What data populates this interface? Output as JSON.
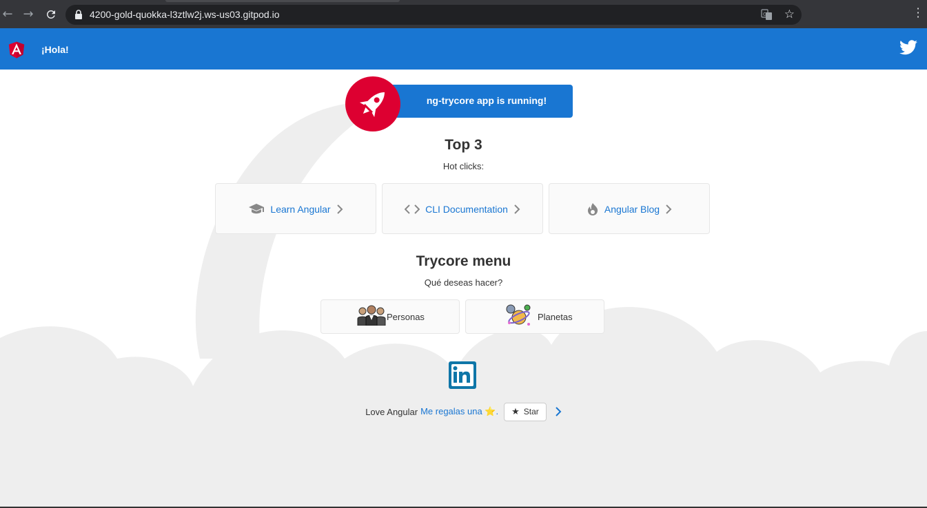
{
  "browser": {
    "url": "4200-gold-quokka-l3ztlw2j.ws-us03.gitpod.io"
  },
  "toolbar": {
    "greeting": "¡Hola!"
  },
  "running_banner": {
    "text": "ng-trycore app is running!"
  },
  "top3": {
    "title": "Top 3",
    "subtitle": "Hot clicks:",
    "cards": [
      {
        "label": "Learn Angular",
        "icon": "graduation-cap-icon"
      },
      {
        "label": "CLI Documentation",
        "icon": "code-icon"
      },
      {
        "label": "Angular Blog",
        "icon": "flame-icon"
      }
    ]
  },
  "trycore_menu": {
    "title": "Trycore menu",
    "subtitle": "Qué deseas hacer?",
    "items": [
      {
        "label": "Personas",
        "icon": "people-icon"
      },
      {
        "label": "Planetas",
        "icon": "planets-icon"
      }
    ]
  },
  "footer": {
    "love_text": "Love Angular",
    "link_text": "Me regalas una ⭐.",
    "star_button": "Star"
  },
  "colors": {
    "primary": "#1976d2",
    "angular_red": "#dd0031",
    "cloud": "#eeeeee"
  }
}
